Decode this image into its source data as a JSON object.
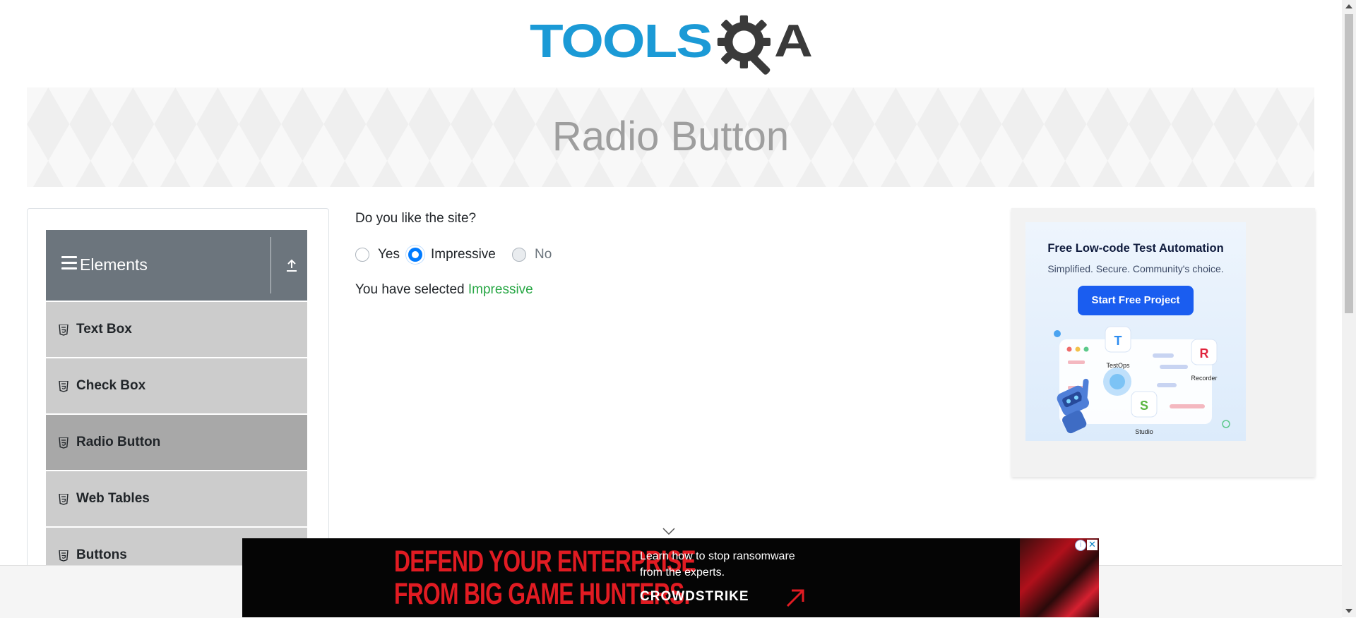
{
  "header": {
    "logo_text": "TOOLSQA",
    "logo_word": "TOOLS",
    "logo_a": "A"
  },
  "banner": {
    "title": "Radio Button"
  },
  "sidebar": {
    "group_title": "Elements",
    "items": [
      {
        "label": "Text Box",
        "active": false
      },
      {
        "label": "Check Box",
        "active": false
      },
      {
        "label": "Radio Button",
        "active": true
      },
      {
        "label": "Web Tables",
        "active": false
      },
      {
        "label": "Buttons",
        "active": false
      }
    ]
  },
  "main": {
    "question": "Do you like the site?",
    "options": [
      {
        "label": "Yes",
        "checked": false,
        "disabled": false
      },
      {
        "label": "Impressive",
        "checked": true,
        "disabled": false
      },
      {
        "label": "No",
        "checked": false,
        "disabled": true
      }
    ],
    "result_prefix": "You have selected",
    "result_value": "Impressive"
  },
  "ad_right": {
    "title": "Free Low-code Test Automation",
    "subtitle": "Simplified. Secure. Community's choice.",
    "cta": "Start Free Project",
    "labels": [
      "TestOps",
      "Recorder",
      "Studio"
    ],
    "accent": "#1a5df0"
  },
  "bottom_ad": {
    "headline_1": "DEFEND YOUR ENTERPRISE",
    "headline_2": "FROM BIG GAME HUNTERS.",
    "copy_1": "Learn how to stop ransomware",
    "copy_2": "from the experts.",
    "brand": "CROWDSTRIKE",
    "info_glyph": "i",
    "close_glyph": "✕",
    "headline_color": "#e11b22"
  },
  "colors": {
    "primary": "#007bff",
    "success": "#28a745",
    "sidebar_header": "#6c757d",
    "sidebar_item": "#cccccc",
    "sidebar_active": "#a8a8a8",
    "logo_blue": "#1b9ad6"
  }
}
